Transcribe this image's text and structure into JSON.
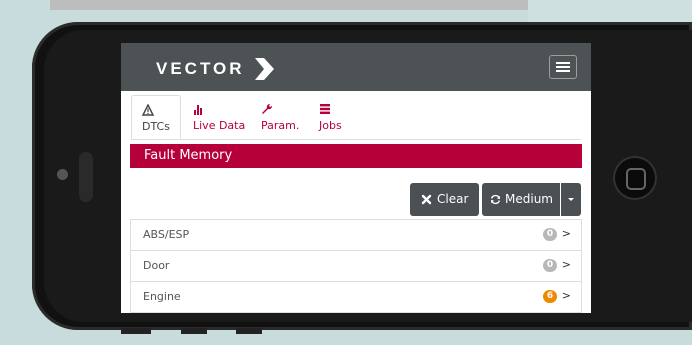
{
  "app": {
    "brand": "VECTOR",
    "colors": {
      "accent": "#b5003a",
      "navbar": "#4d5255",
      "badge_zero": "#b8b8b8",
      "badge_warn": "#ee8a00"
    }
  },
  "tabs": [
    {
      "label": "DTCs",
      "icon": "warning-icon",
      "active": true
    },
    {
      "label": "Live Data",
      "icon": "bar-chart-icon",
      "active": false
    },
    {
      "label": "Param.",
      "icon": "wrench-icon",
      "active": false
    },
    {
      "label": "Jobs",
      "icon": "list-icon",
      "active": false
    }
  ],
  "section": {
    "title": "Fault Memory"
  },
  "toolbar": {
    "clear_label": "Clear",
    "clear_icon": "close-icon",
    "medium_label": "Medium",
    "medium_icon": "refresh-icon",
    "caret_icon": "caret-down-icon"
  },
  "rows": [
    {
      "name": "ABS/ESP",
      "count": "0",
      "status": "zero"
    },
    {
      "name": "Door",
      "count": "0",
      "status": "zero"
    },
    {
      "name": "Engine",
      "count": "6",
      "status": "warn"
    }
  ],
  "chevron": ">"
}
